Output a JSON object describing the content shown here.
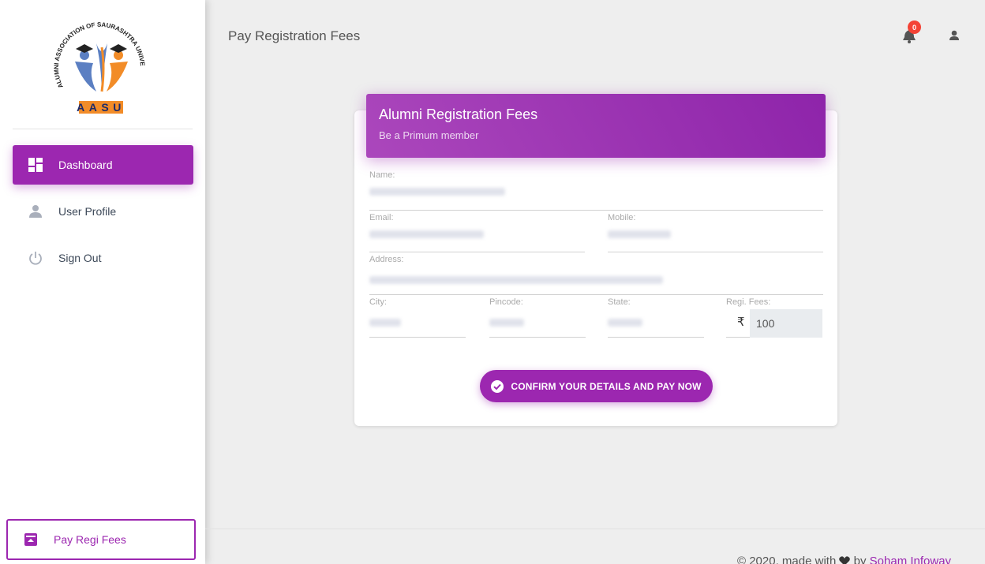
{
  "sidebar": {
    "logo": {
      "ring_text": "ALUMNI ASSOCIATION OF SAURASHTRA UNIVERSITY",
      "wordmark": "AASU"
    },
    "items": [
      {
        "label": "Dashboard",
        "icon": "dashboard-icon",
        "active": true
      },
      {
        "label": "User Profile",
        "icon": "person-icon",
        "active": false
      },
      {
        "label": "Sign Out",
        "icon": "power-icon",
        "active": false
      }
    ],
    "bottom_item": {
      "label": "Pay Regi Fees",
      "icon": "payment-icon"
    }
  },
  "header": {
    "title": "Pay Registration Fees",
    "notification_count": "0"
  },
  "card": {
    "title": "Alumni Registration Fees",
    "subtitle": "Be a Primum member",
    "fields": {
      "name_label": "Name:",
      "email_label": "Email:",
      "mobile_label": "Mobile:",
      "address_label": "Address:",
      "city_label": "City:",
      "pincode_label": "Pincode:",
      "state_label": "State:",
      "fees_label": "Regi. Fees:",
      "currency_symbol": "₹",
      "fees_value": "100"
    },
    "confirm_button": "CONFIRM YOUR DETAILS AND PAY NOW"
  },
  "footer": {
    "prefix": "© 2020, made with",
    "by": "by",
    "brand": "Soham Infoway"
  },
  "colors": {
    "primary": "#9c27b0",
    "badge": "#f44336",
    "logo_orange": "#f28c28",
    "logo_blue": "#5b7fc2"
  }
}
